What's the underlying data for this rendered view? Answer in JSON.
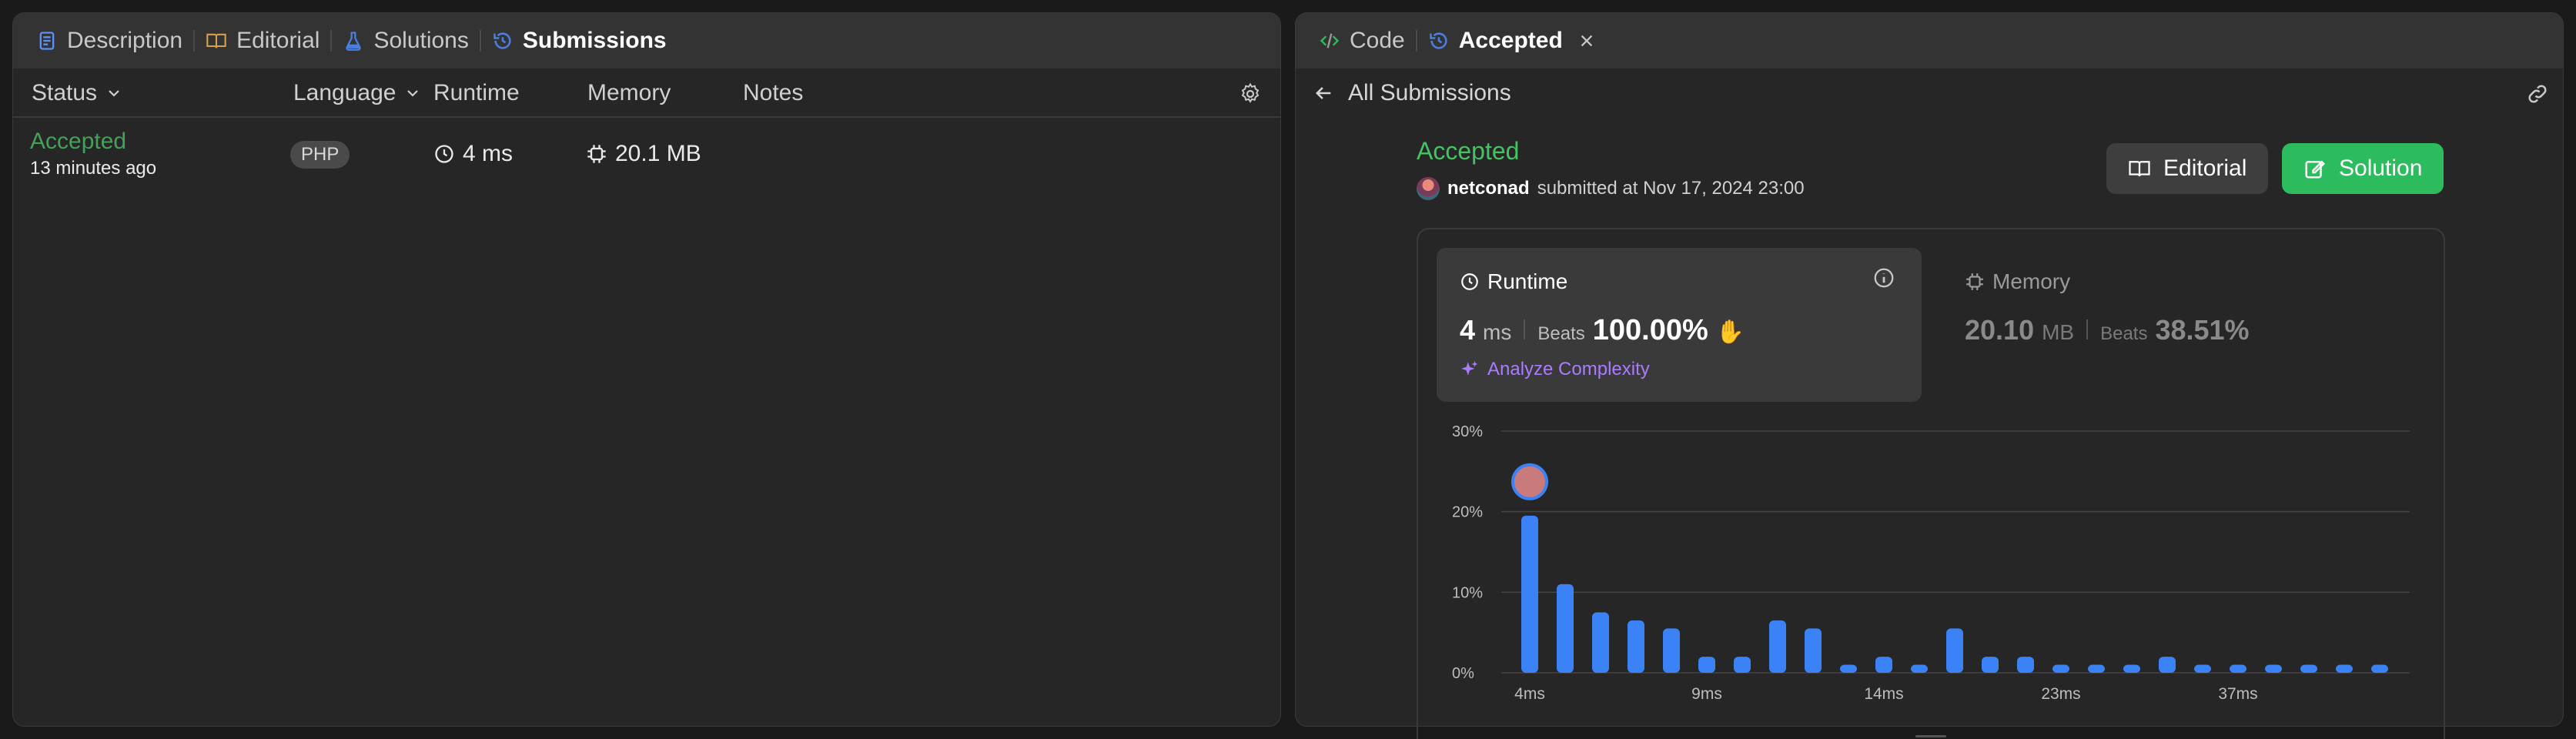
{
  "left": {
    "tabs": [
      {
        "label": "Description",
        "icon": "description-icon",
        "color": "#5b8ff9"
      },
      {
        "label": "Editorial",
        "icon": "book-icon",
        "color": "#d6a14a"
      },
      {
        "label": "Solutions",
        "icon": "flask-icon",
        "color": "#4a7fe0"
      },
      {
        "label": "Submissions",
        "icon": "history-icon",
        "color": "#4a7fe0"
      }
    ],
    "columns": {
      "status": "Status",
      "language": "Language",
      "runtime": "Runtime",
      "memory": "Memory",
      "notes": "Notes"
    },
    "rows": [
      {
        "status": "Accepted",
        "time": "13 minutes ago",
        "language": "PHP",
        "runtime": "4 ms",
        "memory": "20.1 MB"
      }
    ]
  },
  "right": {
    "tabs": {
      "code": "Code",
      "accepted": "Accepted"
    },
    "back_label": "All Submissions",
    "status": "Accepted",
    "user": "netconad",
    "submitted_text": "submitted at Nov 17, 2024 23:00",
    "editorial_label": "Editorial",
    "solution_label": "Solution",
    "runtime": {
      "title": "Runtime",
      "value": "4",
      "unit": "ms",
      "beats_label": "Beats",
      "beats": "100.00%",
      "analyze": "Analyze Complexity"
    },
    "memory": {
      "title": "Memory",
      "value": "20.10",
      "unit": "MB",
      "beats_label": "Beats",
      "beats": "38.51%"
    },
    "colors": {
      "accent_green": "#2cbb5d",
      "bar_blue": "#3b82f6",
      "analyze_purple": "#a97cff",
      "status_green": "#45c262"
    }
  },
  "chart_data": {
    "type": "bar",
    "x_tick_labels": [
      "4ms",
      "9ms",
      "14ms",
      "23ms",
      "37ms"
    ],
    "y_tick_labels": [
      "0%",
      "10%",
      "20%",
      "30%"
    ],
    "ylim": [
      0,
      30
    ],
    "values": [
      19.5,
      11,
      7.5,
      6.5,
      5.5,
      2,
      2,
      6.5,
      5.5,
      1,
      2,
      1,
      5.5,
      2,
      2,
      1,
      1,
      1,
      2,
      1,
      1,
      1,
      1,
      1,
      1
    ],
    "highlight_index": 0
  }
}
